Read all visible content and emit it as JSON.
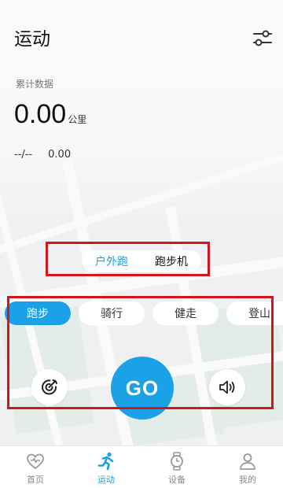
{
  "header": {
    "title": "运动",
    "settings_icon": "sliders-icon"
  },
  "stats": {
    "label": "累计数据",
    "distance_value": "0.00",
    "distance_unit": "公里",
    "pace": "--/--",
    "secondary_value": "0.00"
  },
  "mode_toggle": {
    "options": [
      {
        "label": "户外跑",
        "active": true
      },
      {
        "label": "跑步机",
        "active": false
      }
    ]
  },
  "sport_tabs": [
    {
      "label": "跑步",
      "active": true
    },
    {
      "label": "骑行",
      "active": false
    },
    {
      "label": "健走",
      "active": false
    },
    {
      "label": "登山",
      "active": false
    }
  ],
  "controls": {
    "target_icon": "target-icon",
    "go_label": "GO",
    "sound_icon": "speaker-icon"
  },
  "bottom_nav": [
    {
      "label": "首页",
      "icon": "heart-pulse-icon",
      "active": false
    },
    {
      "label": "运动",
      "icon": "runner-icon",
      "active": true
    },
    {
      "label": "设备",
      "icon": "watch-icon",
      "active": false
    },
    {
      "label": "我的",
      "icon": "user-icon",
      "active": false
    }
  ],
  "colors": {
    "accent": "#1aa1e6",
    "annotation": "#d6141c",
    "background": "#f4f5f6"
  }
}
